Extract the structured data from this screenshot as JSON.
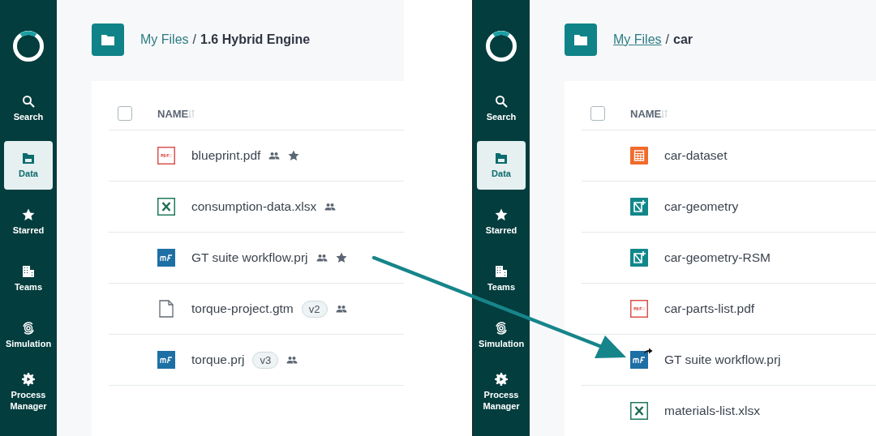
{
  "panels": [
    {
      "sidebar": [
        {
          "kind": "search",
          "label": "Search",
          "selected": false
        },
        {
          "kind": "data",
          "label": "Data",
          "selected": true
        },
        {
          "kind": "starred",
          "label": "Starred",
          "selected": false
        },
        {
          "kind": "teams",
          "label": "Teams",
          "selected": false
        },
        {
          "kind": "simulation",
          "label": "Simulation",
          "selected": false
        },
        {
          "kind": "process",
          "label": "Process Manager",
          "selected": false
        }
      ],
      "breadcrumb": {
        "parent": "My Files",
        "parent_underlined": false,
        "separator": "/",
        "current": "1.6 Hybrid Engine"
      },
      "table": {
        "all_checked": false,
        "column": "NAME",
        "rows": [
          {
            "kind": "pdf",
            "name": "blueprint.pdf",
            "shared": true,
            "starred": true,
            "shortcut": false
          },
          {
            "kind": "excel",
            "name": "consumption-data.xlsx",
            "shared": true,
            "starred": false,
            "shortcut": false
          },
          {
            "kind": "mf",
            "name": "GT suite workflow.prj",
            "shared": true,
            "starred": true,
            "shortcut": false
          },
          {
            "kind": "file",
            "name": "torque-project.gtm",
            "version": "v2",
            "shared": true,
            "starred": false,
            "shortcut": false
          },
          {
            "kind": "mf",
            "name": "torque.prj",
            "version": "v3",
            "shared": true,
            "starred": false,
            "shortcut": false
          }
        ]
      }
    },
    {
      "sidebar": [
        {
          "kind": "search",
          "label": "Search",
          "selected": false
        },
        {
          "kind": "data",
          "label": "Data",
          "selected": true
        },
        {
          "kind": "starred",
          "label": "Starred",
          "selected": false
        },
        {
          "kind": "teams",
          "label": "Teams",
          "selected": false
        },
        {
          "kind": "simulation",
          "label": "Simulation",
          "selected": false
        },
        {
          "kind": "process",
          "label": "Process Manager",
          "selected": false
        }
      ],
      "breadcrumb": {
        "parent": "My Files",
        "parent_underlined": true,
        "separator": "/",
        "current": "car"
      },
      "table": {
        "all_checked": false,
        "column": "NAME",
        "rows": [
          {
            "kind": "dataset",
            "name": "car-dataset",
            "shared": false,
            "starred": false,
            "shortcut": false
          },
          {
            "kind": "geometry",
            "name": "car-geometry",
            "shared": false,
            "starred": false,
            "shortcut": false
          },
          {
            "kind": "geometry",
            "name": "car-geometry-RSM",
            "shared": false,
            "starred": false,
            "shortcut": false
          },
          {
            "kind": "pdf",
            "name": "car-parts-list.pdf",
            "shared": false,
            "starred": false,
            "shortcut": false
          },
          {
            "kind": "mf",
            "name": "GT suite workflow.prj",
            "shared": false,
            "starred": false,
            "shortcut": true
          },
          {
            "kind": "excel",
            "name": "materials-list.xlsx",
            "shared": false,
            "starred": false,
            "shortcut": false
          }
        ]
      }
    }
  ]
}
